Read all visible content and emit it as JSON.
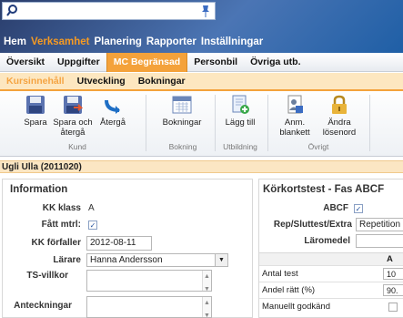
{
  "topnav": {
    "items": [
      "Hem",
      "Verksamhet",
      "Planering",
      "Rapporter",
      "Inställningar"
    ],
    "active_index": 1
  },
  "subnav": {
    "items": [
      "Översikt",
      "Uppgifter",
      "MC Begränsad",
      "Personbil",
      "Övriga utb."
    ],
    "active_index": 2
  },
  "tertnav": {
    "items": [
      "Kursinnehåll",
      "Utveckling",
      "Bokningar"
    ],
    "active_index": 0
  },
  "ribbon": {
    "buttons": {
      "spara": "Spara",
      "spara_aterga": "Spara och återgå",
      "aterga": "Återgå",
      "bokningar": "Bokningar",
      "lagg_till": "Lägg till",
      "anm_blankett": "Anm. blankett",
      "andra_losenord": "Ändra lösenord"
    },
    "groups": {
      "kund": "Kund",
      "bokning": "Bokning",
      "utbildning": "Utbildning",
      "ovrigt": "Övrigt"
    }
  },
  "user": {
    "name": "Ugli Ulla (2011020)"
  },
  "information": {
    "title": "Information",
    "kk_klass_label": "KK klass",
    "kk_klass_value": "A",
    "fatt_mtrl_label": "Fått mtrl:",
    "fatt_mtrl_checked": true,
    "kk_forfaller_label": "KK förfaller",
    "kk_forfaller_value": "2012-08-11",
    "larare_label": "Lärare",
    "larare_value": "Hanna Andersson",
    "ts_villkor_label": "TS-villkor",
    "anteckningar_label": "Anteckningar"
  },
  "korkort": {
    "title": "Körkortstest - Fas ABCF",
    "abcf_label": "ABCF",
    "abcf_checked": true,
    "rep_label": "Rep/Sluttest/Extra",
    "rep_value": "Repetition",
    "laromedel_label": "Läromedel",
    "table": {
      "col_header": "A",
      "rows": [
        {
          "label": "Antal test",
          "value": "10"
        },
        {
          "label": "Andel rätt (%)",
          "value": "90."
        },
        {
          "label": "Manuellt godkänd",
          "value": ""
        }
      ]
    }
  },
  "colors": {
    "accent": "#f4a23b",
    "nav_bg": "#2a3d6b",
    "panel_header_bg": "#fbe6c3"
  }
}
